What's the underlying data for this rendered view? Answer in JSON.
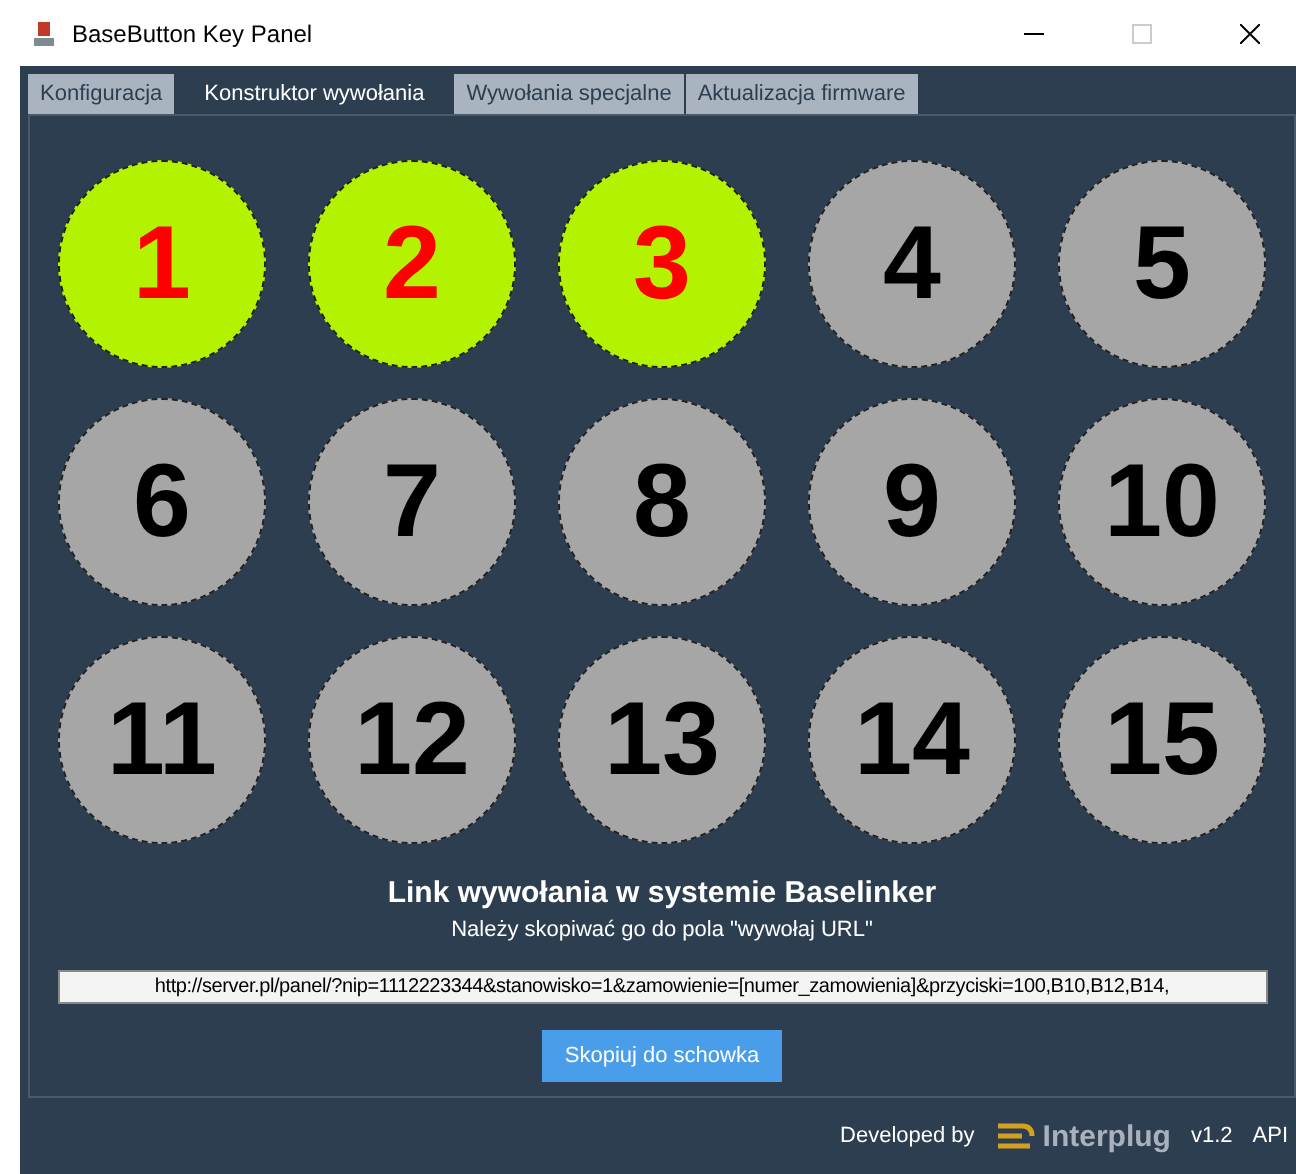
{
  "window": {
    "title": "BaseButton Key Panel"
  },
  "tabs": [
    {
      "label": "Konfiguracja",
      "selected": false
    },
    {
      "label": "Konstruktor wywołania",
      "selected": true
    },
    {
      "label": "Wywołania specjalne",
      "selected": false
    },
    {
      "label": "Aktualizacja firmware",
      "selected": false
    }
  ],
  "keys": [
    {
      "label": "1",
      "on": true
    },
    {
      "label": "2",
      "on": true
    },
    {
      "label": "3",
      "on": true
    },
    {
      "label": "4",
      "on": false
    },
    {
      "label": "5",
      "on": false
    },
    {
      "label": "6",
      "on": false
    },
    {
      "label": "7",
      "on": false
    },
    {
      "label": "8",
      "on": false
    },
    {
      "label": "9",
      "on": false
    },
    {
      "label": "10",
      "on": false
    },
    {
      "label": "11",
      "on": false
    },
    {
      "label": "12",
      "on": false
    },
    {
      "label": "13",
      "on": false
    },
    {
      "label": "14",
      "on": false
    },
    {
      "label": "15",
      "on": false
    }
  ],
  "link": {
    "heading": "Link wywołania w systemie Baselinker",
    "hint": "Należy skopiwać go do pola \"wywołaj URL\"",
    "url": "http://server.pl/panel/?nip=1112223344&stanowisko=1&zamowienie=[numer_zamowienia]&przyciski=100,B10,B12,B14,",
    "copy_button": "Skopiuj do schowka"
  },
  "footer": {
    "developed_by": "Developed by",
    "brand": "Interplug",
    "version": "v1.2",
    "api": "API"
  }
}
